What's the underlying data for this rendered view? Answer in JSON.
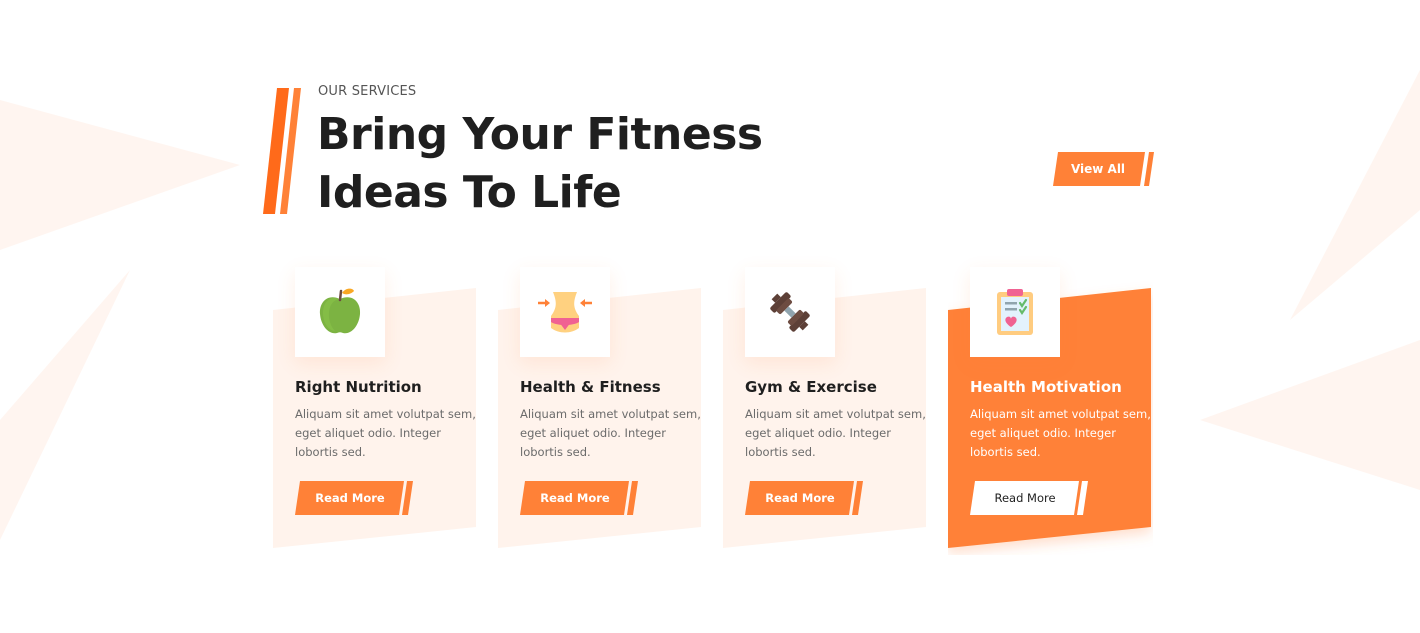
{
  "section": {
    "eyebrow": "OUR SERVICES",
    "title_line1": "Bring Your Fitness",
    "title_line2": "Ideas To Life",
    "view_all_label": "View All"
  },
  "colors": {
    "accent": "#ff8137",
    "accent_dark": "#ff6a1a",
    "card_bg": "#fff3ec",
    "text_dark": "#1f1f1f",
    "text_muted": "#6b6b6b"
  },
  "services": [
    {
      "title": "Right Nutrition",
      "text": "Aliquam sit amet volutpat sem, eget aliquet odio. Integer lobortis sed.",
      "button": "Read More",
      "icon": "apple-icon",
      "active": false
    },
    {
      "title": "Health & Fitness",
      "text": "Aliquam sit amet volutpat sem, eget aliquet odio. Integer lobortis sed.",
      "button": "Read More",
      "icon": "waist-icon",
      "active": false
    },
    {
      "title": "Gym & Exercise",
      "text": "Aliquam sit amet volutpat sem, eget aliquet odio. Integer lobortis sed.",
      "button": "Read More",
      "icon": "dumbbell-icon",
      "active": false
    },
    {
      "title": "Health Motivation",
      "text": "Aliquam sit amet volutpat sem, eget aliquet odio. Integer lobortis sed.",
      "button": "Read More",
      "icon": "clipboard-icon",
      "active": true
    }
  ]
}
